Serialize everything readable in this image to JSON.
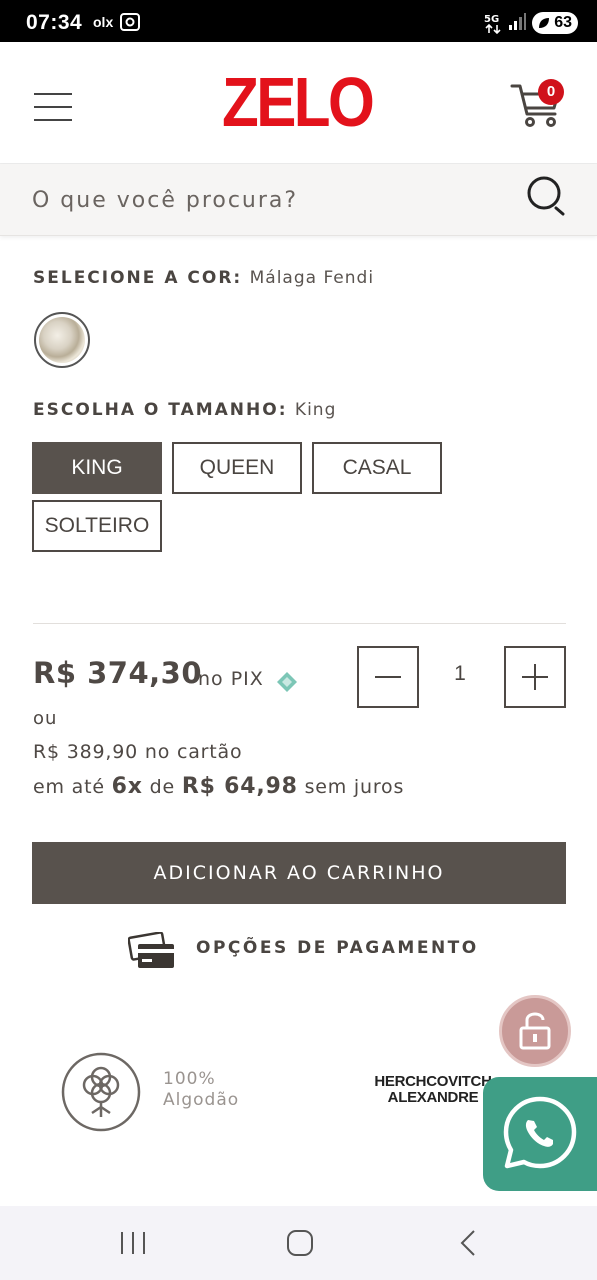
{
  "status_bar": {
    "time": "07:34",
    "olx_label": "olx",
    "network": "5G",
    "battery": "63"
  },
  "header": {
    "logo_text": "ZELO",
    "cart_count": "0",
    "brand_color": "#e3121b"
  },
  "search": {
    "placeholder": "O que você procura?"
  },
  "color_selector": {
    "label": "SELECIONE A COR:",
    "value": "Málaga Fendi"
  },
  "size_selector": {
    "label": "ESCOLHA O TAMANHO:",
    "value": "King",
    "options": [
      "KING",
      "QUEEN",
      "CASAL",
      "SOLTEIRO"
    ],
    "selected": "KING"
  },
  "price": {
    "pix_value": "R$ 374,30",
    "pix_suffix": "no PIX",
    "or_text": "ou",
    "card_value": "R$ 389,90",
    "card_suffix": "no cartão",
    "installment_prefix": "em até",
    "installment_count": "6x",
    "installment_of": "de",
    "installment_value": "R$ 64,98",
    "installment_suffix": "sem juros"
  },
  "quantity": {
    "value": "1"
  },
  "actions": {
    "add_to_cart": "ADICIONAR AO CARRINHO",
    "payment_options": "OPÇÕES DE PAGAMENTO"
  },
  "features": {
    "cotton_line1": "100%",
    "cotton_line2": "Algodão",
    "brand_line1": "HERCHCOVITCH",
    "brand_line2": "ALEXANDRE"
  },
  "icons": {
    "menu": "hamburger-icon",
    "cart": "cart-icon",
    "search": "search-icon",
    "pix": "pix-icon",
    "card": "credit-card-icon",
    "cotton": "cotton-flower-icon",
    "lock": "lock-icon",
    "whatsapp": "whatsapp-icon"
  },
  "colors": {
    "primary_dark": "#58524d",
    "whatsapp_green": "#3f9e86",
    "lock_pink": "#c99a98",
    "pix_teal": "#7cc6b6"
  }
}
